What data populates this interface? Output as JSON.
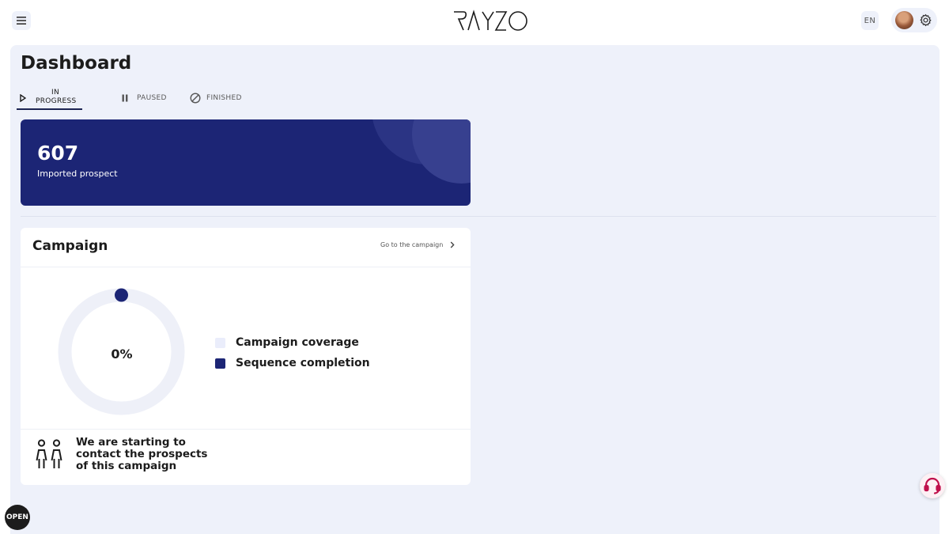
{
  "header": {
    "logo_text": "RAYZO",
    "language": "EN"
  },
  "page": {
    "title": "Dashboard"
  },
  "tabs": [
    {
      "label": "IN PROGRESS",
      "active": true
    },
    {
      "label": "PAUSED",
      "active": false
    },
    {
      "label": "FINISHED",
      "active": false
    }
  ],
  "stat": {
    "value": "607",
    "label": "Imported prospect"
  },
  "campaign": {
    "title": "Campaign",
    "link_label": "Go to the campaign",
    "percent": "0%",
    "progress": 0,
    "legend": [
      {
        "label": "Campaign coverage",
        "color": "#eaedfb"
      },
      {
        "label": "Sequence completion",
        "color": "#1c2575"
      }
    ],
    "message": "We are starting to contact the prospects of this campaign"
  },
  "colors": {
    "primary": "#1c2575",
    "panel": "#eef1fa",
    "ring": "#eef0f8"
  },
  "icons": {
    "menu": "menu-icon",
    "settings": "gear-icon",
    "play": "play-icon",
    "pause": "pause-icon",
    "finished": "circle-slash-icon",
    "chevron": "chevron-right-icon",
    "people": "people-icon",
    "support": "headset-icon",
    "open": "open-icon"
  },
  "fab": {
    "open_label": "OPEN"
  }
}
